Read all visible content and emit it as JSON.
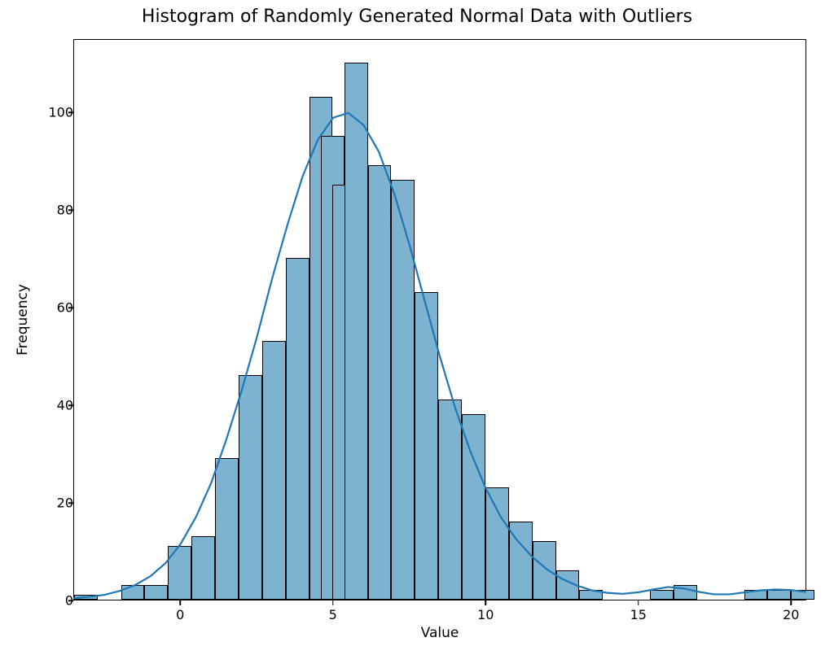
{
  "chart_data": {
    "type": "bar",
    "title": "Histogram of Randomly Generated Normal Data with Outliers",
    "xlabel": "Value",
    "ylabel": "Frequency",
    "x_ticks": [
      0,
      5,
      10,
      15,
      20
    ],
    "y_ticks": [
      0,
      20,
      40,
      60,
      80,
      100
    ],
    "xlim": [
      -3.5,
      20.5
    ],
    "ylim": [
      0,
      115
    ],
    "bin_width": 0.77,
    "bars": [
      {
        "x": -3.12,
        "height": 1
      },
      {
        "x": -2.35,
        "height": 0
      },
      {
        "x": -1.58,
        "height": 3
      },
      {
        "x": -0.81,
        "height": 3
      },
      {
        "x": -0.04,
        "height": 11
      },
      {
        "x": 0.73,
        "height": 13
      },
      {
        "x": 1.5,
        "height": 29
      },
      {
        "x": 2.27,
        "height": 46
      },
      {
        "x": 3.04,
        "height": 53
      },
      {
        "x": 3.81,
        "height": 70
      },
      {
        "x": 4.58,
        "height": 103
      },
      {
        "x": 5.35,
        "height": 85
      },
      {
        "x": 4.965,
        "height": 95
      },
      {
        "x": 5.735,
        "height": 110
      },
      {
        "x": 6.5,
        "height": 89
      },
      {
        "x": 7.27,
        "height": 86
      },
      {
        "x": 8.04,
        "height": 63
      },
      {
        "x": 8.81,
        "height": 41
      },
      {
        "x": 9.58,
        "height": 38
      },
      {
        "x": 10.35,
        "height": 23
      },
      {
        "x": 11.12,
        "height": 16
      },
      {
        "x": 11.89,
        "height": 12
      },
      {
        "x": 12.66,
        "height": 6
      },
      {
        "x": 13.43,
        "height": 2
      },
      {
        "x": 14.2,
        "height": 0
      },
      {
        "x": 14.97,
        "height": 0
      },
      {
        "x": 15.74,
        "height": 2
      },
      {
        "x": 16.51,
        "height": 3
      },
      {
        "x": 17.28,
        "height": 0
      },
      {
        "x": 18.05,
        "height": 0
      },
      {
        "x": 18.82,
        "height": 2
      },
      {
        "x": 19.59,
        "height": 2
      },
      {
        "x": 20.36,
        "height": 2
      }
    ],
    "kde": {
      "x": [
        -3.5,
        -3,
        -2.5,
        -2,
        -1.5,
        -1,
        -0.5,
        0,
        0.5,
        1,
        1.5,
        2,
        2.5,
        3,
        3.5,
        4,
        4.5,
        5,
        5.5,
        6,
        6.5,
        7,
        7.5,
        8,
        8.5,
        9,
        9.5,
        10,
        10.5,
        11,
        11.5,
        12,
        12.5,
        13,
        13.5,
        14,
        14.5,
        15,
        15.5,
        16,
        16.5,
        17,
        17.5,
        18,
        18.5,
        19,
        19.5,
        20,
        20.5
      ],
      "y": [
        0.3,
        0.6,
        1.0,
        1.8,
        3.0,
        4.8,
        7.5,
        11.5,
        17.0,
        24.0,
        33.0,
        43.0,
        54.0,
        66.0,
        77.0,
        87.0,
        94.5,
        99.0,
        100.0,
        97.5,
        92.0,
        83.5,
        73.0,
        61.5,
        50.0,
        39.5,
        30.5,
        23.0,
        17.0,
        12.5,
        9.0,
        6.3,
        4.3,
        2.9,
        1.9,
        1.4,
        1.2,
        1.5,
        2.1,
        2.6,
        2.3,
        1.6,
        1.1,
        1.1,
        1.5,
        1.9,
        2.1,
        2.0,
        1.6
      ]
    }
  }
}
